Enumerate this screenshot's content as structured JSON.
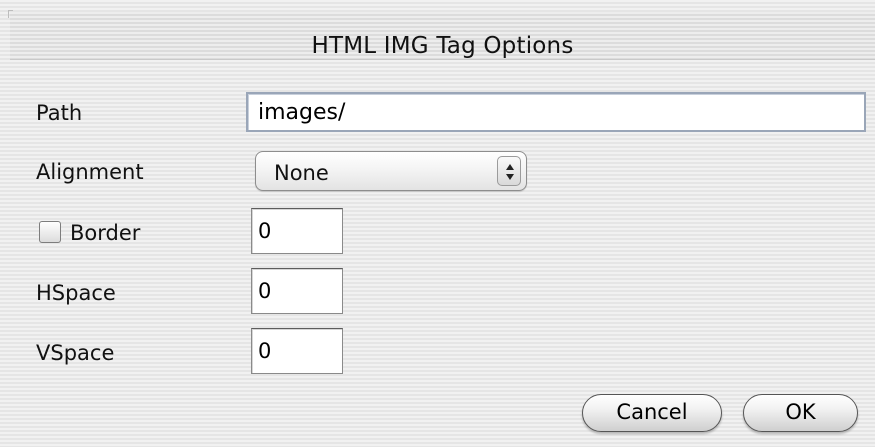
{
  "dialog": {
    "title": "HTML IMG Tag Options"
  },
  "fields": {
    "path_label": "Path",
    "path_value": "images/",
    "alignment_label": "Alignment",
    "alignment_value": "None",
    "border_label": "Border",
    "border_checked": false,
    "border_value": "0",
    "hspace_label": "HSpace",
    "hspace_value": "0",
    "vspace_label": "VSpace",
    "vspace_value": "0"
  },
  "buttons": {
    "cancel_label": "Cancel",
    "ok_label": "OK"
  },
  "icons": {
    "popup_arrows": "up-down-arrows-icon"
  }
}
